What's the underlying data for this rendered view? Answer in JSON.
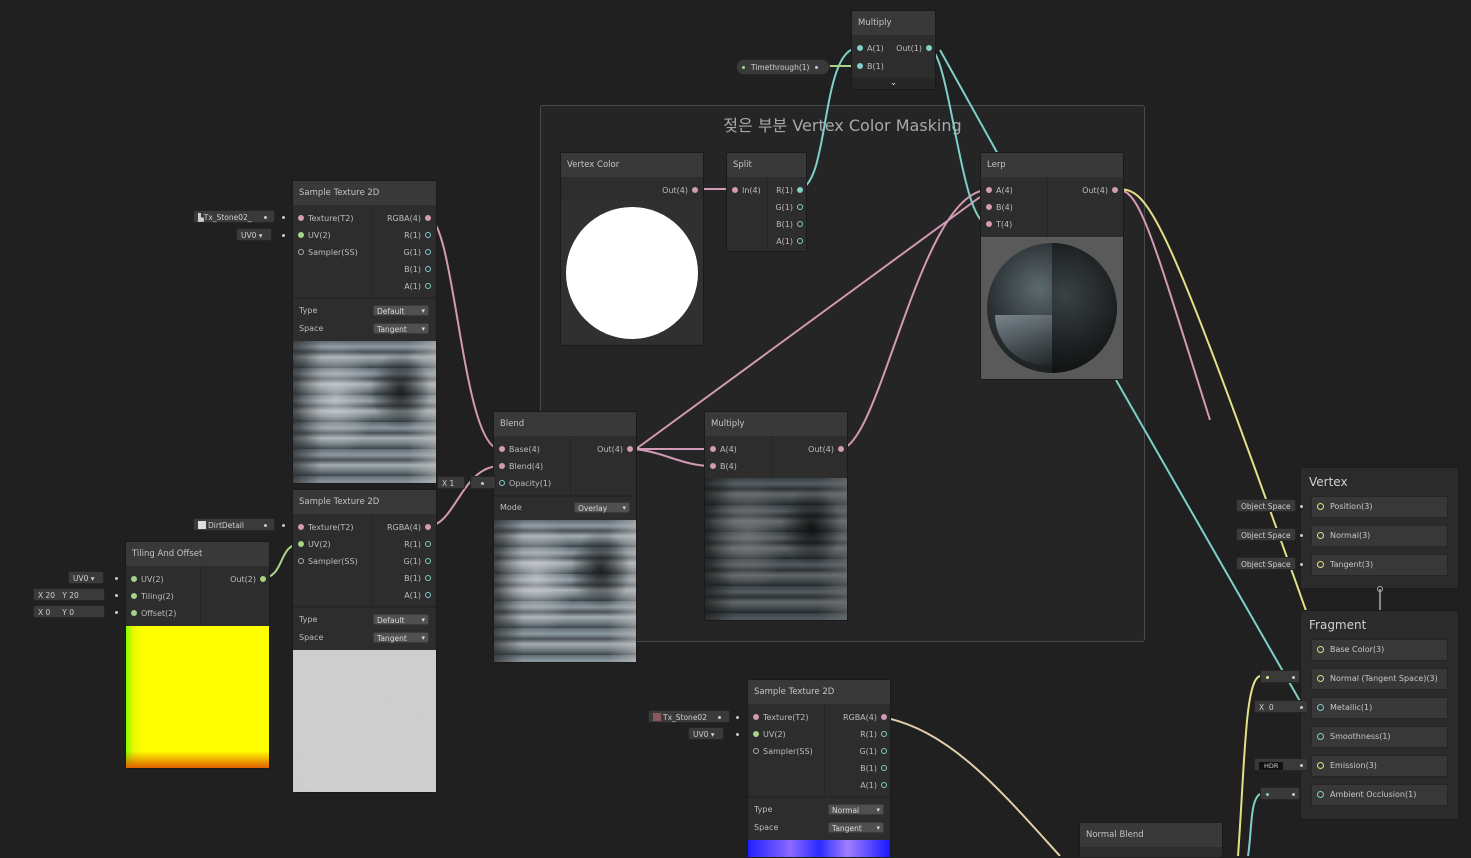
{
  "group": {
    "title": "젖은 부분 Vertex Color Masking"
  },
  "nodes": {
    "multiply_top": {
      "title": "Multiply",
      "in_a": "A(1)",
      "in_b": "B(1)",
      "out": "Out(1)",
      "expand": "⌄"
    },
    "timethrough": {
      "label": "Timethrough(1)"
    },
    "vertex_color": {
      "title": "Vertex Color",
      "out": "Out(4)"
    },
    "split": {
      "title": "Split",
      "in": "In(4)",
      "outs": [
        "R(1)",
        "G(1)",
        "B(1)",
        "A(1)"
      ]
    },
    "lerp": {
      "title": "Lerp",
      "ins": [
        "A(4)",
        "B(4)",
        "T(4)"
      ],
      "out": "Out(4)"
    },
    "sample1": {
      "title": "Sample Texture 2D",
      "ins": [
        "Texture(T2)",
        "UV(2)",
        "Sampler(SS)"
      ],
      "outs": [
        "RGBA(4)",
        "R(1)",
        "G(1)",
        "B(1)",
        "A(1)"
      ],
      "type_label": "Type",
      "type_value": "Default",
      "space_label": "Space",
      "space_value": "Tangent"
    },
    "sample2": {
      "title": "Sample Texture 2D",
      "ins": [
        "Texture(T2)",
        "UV(2)",
        "Sampler(SS)"
      ],
      "outs": [
        "RGBA(4)",
        "R(1)",
        "G(1)",
        "B(1)",
        "A(1)"
      ],
      "type_label": "Type",
      "type_value": "Default",
      "space_label": "Space",
      "space_value": "Tangent"
    },
    "sample3": {
      "title": "Sample Texture 2D",
      "ins": [
        "Texture(T2)",
        "UV(2)",
        "Sampler(SS)"
      ],
      "outs": [
        "RGBA(4)",
        "R(1)",
        "G(1)",
        "B(1)",
        "A(1)"
      ],
      "type_label": "Type",
      "type_value": "Normal",
      "space_label": "Space",
      "space_value": "Tangent"
    },
    "blend": {
      "title": "Blend",
      "ins": [
        "Base(4)",
        "Blend(4)",
        "Opacity(1)"
      ],
      "out": "Out(4)",
      "mode_label": "Mode",
      "mode_value": "Overlay"
    },
    "multiply_mid": {
      "title": "Multiply",
      "ins": [
        "A(4)",
        "B(4)"
      ],
      "out": "Out(4)"
    },
    "tiling": {
      "title": "Tiling And Offset",
      "ins": [
        "UV(2)",
        "Tiling(2)",
        "Offset(2)"
      ],
      "out": "Out(2)"
    },
    "normal_blend": {
      "title": "Normal Blend"
    }
  },
  "inline_fields": {
    "tex1": "Tx_Stone02_",
    "uv1": "UV0",
    "tex2": "DirtDetail",
    "opacity_x": "X",
    "opacity_val": "1",
    "tiling_uv": "UV0",
    "tiling_x_label": "X",
    "tiling_x": "20",
    "tiling_y_label": "Y",
    "tiling_y": "20",
    "offset_x_label": "X",
    "offset_x": "0",
    "offset_y_label": "Y",
    "offset_y": "0",
    "tex3": "Tx_Stone02",
    "uv3": "UV0",
    "metallic_x": "X",
    "metallic_val": "0",
    "hdr": "HDR"
  },
  "master": {
    "vertex_title": "Vertex",
    "vertex_slots": [
      {
        "space": "Object Space",
        "label": "Position(3)"
      },
      {
        "space": "Object Space",
        "label": "Normal(3)"
      },
      {
        "space": "Object Space",
        "label": "Tangent(3)"
      }
    ],
    "fragment_title": "Fragment",
    "fragment_slots": [
      "Base Color(3)",
      "Normal (Tangent Space)(3)",
      "Metallic(1)",
      "Smoothness(1)",
      "Emission(3)",
      "Ambient Occlusion(1)"
    ]
  },
  "colors": {
    "pink": "#d29ab4",
    "teal": "#7fd0c6",
    "green": "#a8d488",
    "yellow": "#e2e086",
    "background": "#202020"
  },
  "icons": [
    "texture-icon",
    "target-icon",
    "chevron-down-icon"
  ]
}
